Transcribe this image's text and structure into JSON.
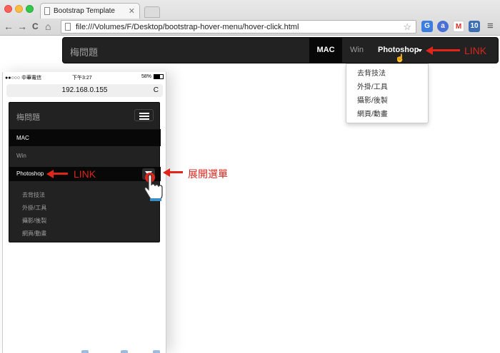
{
  "browser": {
    "tab_title": "Bootstrap Template",
    "tab_close": "✕",
    "back": "←",
    "forward": "→",
    "reload": "C",
    "home": "⌂",
    "url": "file:///Volumes/F/Desktop/bootstrap-hover-menu/hover-click.html",
    "star": "☆",
    "menu": "≡"
  },
  "desktop_nav": {
    "brand": "梅問題",
    "items": [
      "MAC",
      "Win",
      "Photoshop"
    ],
    "active": "MAC",
    "dropdown": [
      "去背技法",
      "外掛/工具",
      "攝影/後製",
      "網頁/動畫"
    ]
  },
  "annotations": {
    "link_desktop": "LINK",
    "link_mobile": "LINK",
    "expand_menu": "展開選單",
    "accent_color": "#e1251b"
  },
  "phone": {
    "carrier": "●●○○○ 中華電信",
    "time": "下午3:27",
    "battery": "58%",
    "url": "192.168.0.155",
    "reload": "C",
    "nav": {
      "brand": "梅問題",
      "items": [
        "MAC",
        "Win",
        "Photoshop"
      ],
      "submenu": [
        "去背技法",
        "外掛/工具",
        "攝影/後製",
        "網頁/動畫"
      ]
    }
  }
}
